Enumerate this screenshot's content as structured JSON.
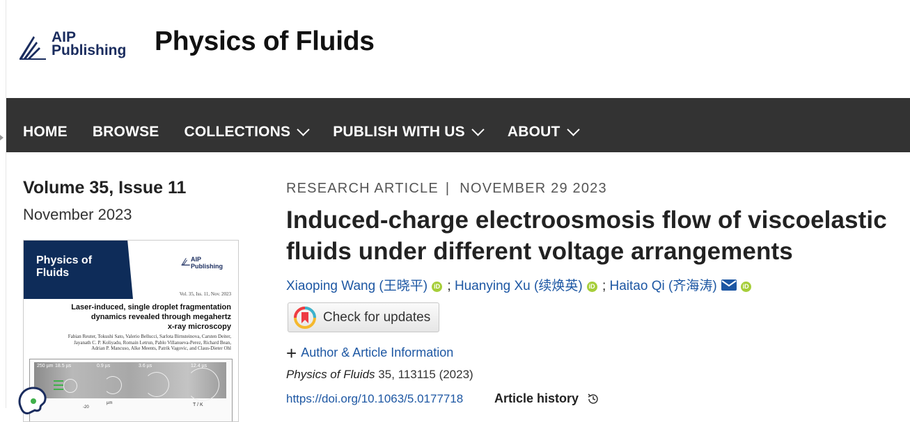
{
  "publisher": {
    "logo_line1": "AIP",
    "logo_line2": "Publishing"
  },
  "journal": {
    "title": "Physics of Fluids"
  },
  "nav": {
    "items": [
      {
        "label": "HOME",
        "dropdown": false
      },
      {
        "label": "BROWSE",
        "dropdown": false
      },
      {
        "label": "COLLECTIONS",
        "dropdown": true
      },
      {
        "label": "PUBLISH WITH US",
        "dropdown": true
      },
      {
        "label": "ABOUT",
        "dropdown": true
      }
    ]
  },
  "issue": {
    "volume": "Volume 35, Issue 11",
    "date": "November 2023"
  },
  "cover": {
    "journal_line1": "Physics of",
    "journal_line2": "Fluids",
    "logo_line1": "AIP",
    "logo_line2": "Publishing",
    "vol_line": "Vol. 35, Iss. 11, Nov. 2023",
    "title_line1": "Laser-induced, single droplet fragmentation",
    "title_line2": "dynamics revealed through megahertz",
    "title_line3": "x-ray microscopy",
    "authors_line1": "Fabian Reuter, Tokushi Sato, Valerio Bellucci, Sarlota Birnsteinova, Carsten Deiter,",
    "authors_line2": "Jayanath C. P. Koliyadu, Romain Letrun, Pablo Villanueva-Perez, Richard Bean,",
    "authors_line3": "Adrian P. Mancuso, Alke Meents, Patrik Vagovic, and Claus-Dieter Ohl",
    "fig_labels": [
      "250 µm",
      "18.5 µs",
      "0.9 µs",
      "3.6 µs",
      "12.4 µs"
    ],
    "fig_bottom_labels": [
      "-20",
      "µm",
      "T / K"
    ]
  },
  "article": {
    "type": "RESEARCH ARTICLE",
    "separator": "|",
    "date": "NOVEMBER 29 2023",
    "title": "Induced-charge electroosmosis flow of viscoelastic fluids under different voltage arrangements",
    "authors": [
      {
        "name": "Xiaoping Wang (王晓平)",
        "orcid": true,
        "email": false
      },
      {
        "name": "Huanying Xu (续焕英)",
        "orcid": true,
        "email": false
      },
      {
        "name": "Haitao Qi (齐海涛)",
        "orcid": true,
        "email": true
      }
    ],
    "author_separator": ";",
    "orcid_label": "iD",
    "check_updates_label": "Check for updates",
    "author_info_label": "Author & Article Information",
    "citation_journal": "Physics of Fluids",
    "citation_rest": "35, 113115 (2023)",
    "doi": "https://doi.org/10.1063/5.0177718",
    "history_label": "Article history"
  },
  "colors": {
    "nav_bg": "#333333",
    "link": "#1d57a3",
    "orcid": "#a6ce39",
    "brand_navy": "#1a2c5e"
  },
  "icons": [
    "aip-logo-icon",
    "chevron-down-icon",
    "orcid-icon",
    "mail-icon",
    "crossmark-icon",
    "plus-icon",
    "clock-history-icon",
    "chat-bubble-icon"
  ]
}
